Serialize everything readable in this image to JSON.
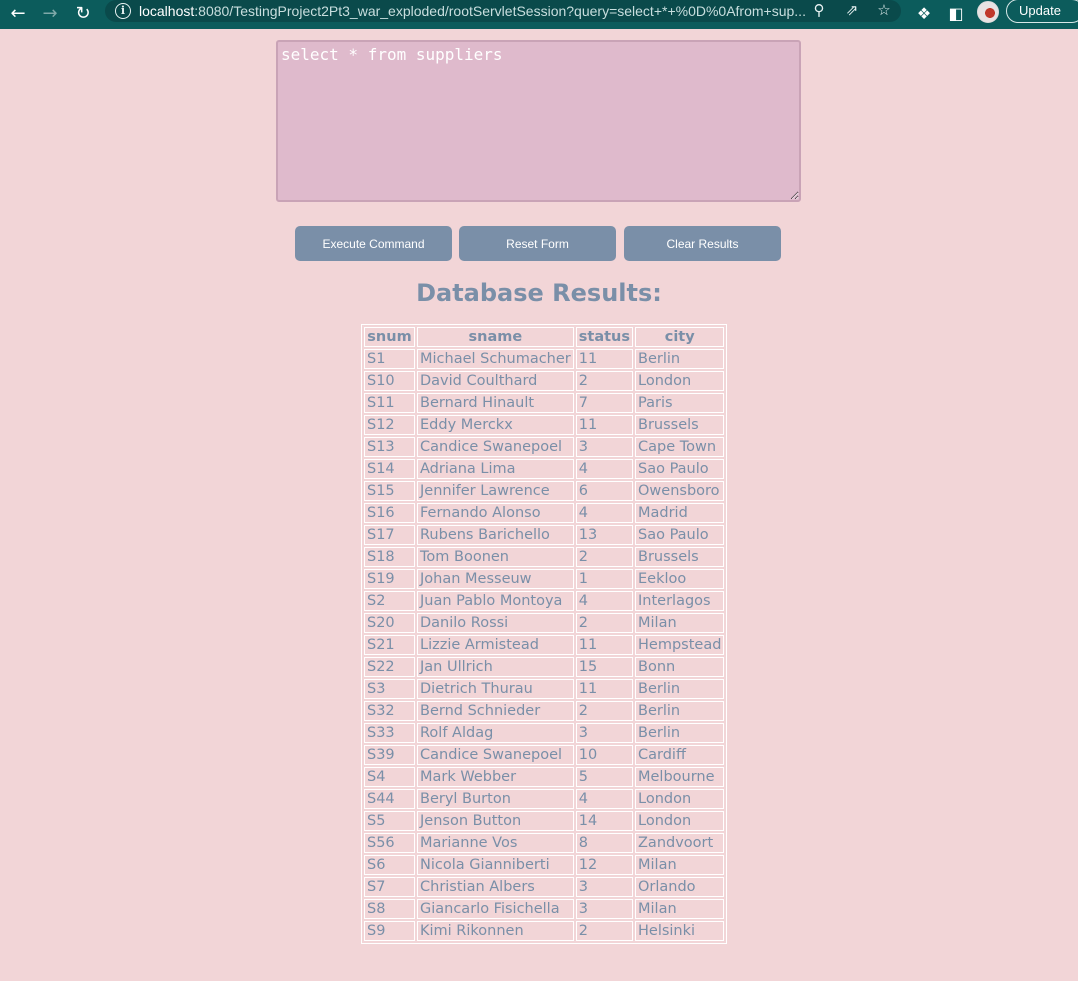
{
  "browser": {
    "url_host": "localhost",
    "url_rest": ":8080/TestingProject2Pt3_war_exploded/rootServletSession?query=select+*+%0D%0Afrom+sup...",
    "update_label": "Update",
    "icons": {
      "back": "back-arrow-icon",
      "forward": "forward-arrow-icon",
      "reload": "reload-icon",
      "info": "info-icon",
      "zoom": "zoom-icon",
      "share": "share-icon",
      "bookmark": "star-icon",
      "extensions": "puzzle-icon",
      "sidepanel": "side-panel-icon",
      "profile": "avatar"
    }
  },
  "query": {
    "value": "select * from suppliers"
  },
  "buttons": {
    "execute": "Execute Command",
    "reset": "Reset Form",
    "clear": "Clear Results"
  },
  "results": {
    "title": "Database Results:",
    "columns": [
      "snum",
      "sname",
      "status",
      "city"
    ],
    "rows": [
      [
        "S1",
        "Michael Schumacher",
        "11",
        "Berlin"
      ],
      [
        "S10",
        "David Coulthard",
        "2",
        "London"
      ],
      [
        "S11",
        "Bernard Hinault",
        "7",
        "Paris"
      ],
      [
        "S12",
        "Eddy Merckx",
        "11",
        "Brussels"
      ],
      [
        "S13",
        "Candice Swanepoel",
        "3",
        "Cape Town"
      ],
      [
        "S14",
        "Adriana Lima",
        "4",
        "Sao Paulo"
      ],
      [
        "S15",
        "Jennifer Lawrence",
        "6",
        "Owensboro"
      ],
      [
        "S16",
        "Fernando Alonso",
        "4",
        "Madrid"
      ],
      [
        "S17",
        "Rubens Barichello",
        "13",
        "Sao Paulo"
      ],
      [
        "S18",
        "Tom Boonen",
        "2",
        "Brussels"
      ],
      [
        "S19",
        "Johan Messeuw",
        "1",
        "Eekloo"
      ],
      [
        "S2",
        "Juan Pablo Montoya",
        "4",
        "Interlagos"
      ],
      [
        "S20",
        "Danilo Rossi",
        "2",
        "Milan"
      ],
      [
        "S21",
        "Lizzie Armistead",
        "11",
        "Hempstead"
      ],
      [
        "S22",
        "Jan Ullrich",
        "15",
        "Bonn"
      ],
      [
        "S3",
        "Dietrich Thurau",
        "11",
        "Berlin"
      ],
      [
        "S32",
        "Bernd Schnieder",
        "2",
        "Berlin"
      ],
      [
        "S33",
        "Rolf Aldag",
        "3",
        "Berlin"
      ],
      [
        "S39",
        "Candice Swanepoel",
        "10",
        "Cardiff"
      ],
      [
        "S4",
        "Mark Webber",
        "5",
        "Melbourne"
      ],
      [
        "S44",
        "Beryl Burton",
        "4",
        "London"
      ],
      [
        "S5",
        "Jenson Button",
        "14",
        "London"
      ],
      [
        "S56",
        "Marianne Vos",
        "8",
        "Zandvoort"
      ],
      [
        "S6",
        "Nicola Gianniberti",
        "12",
        "Milan"
      ],
      [
        "S7",
        "Christian Albers",
        "3",
        "Orlando"
      ],
      [
        "S8",
        "Giancarlo Fisichella",
        "3",
        "Milan"
      ],
      [
        "S9",
        "Kimi Rikonnen",
        "2",
        "Helsinki"
      ]
    ]
  }
}
